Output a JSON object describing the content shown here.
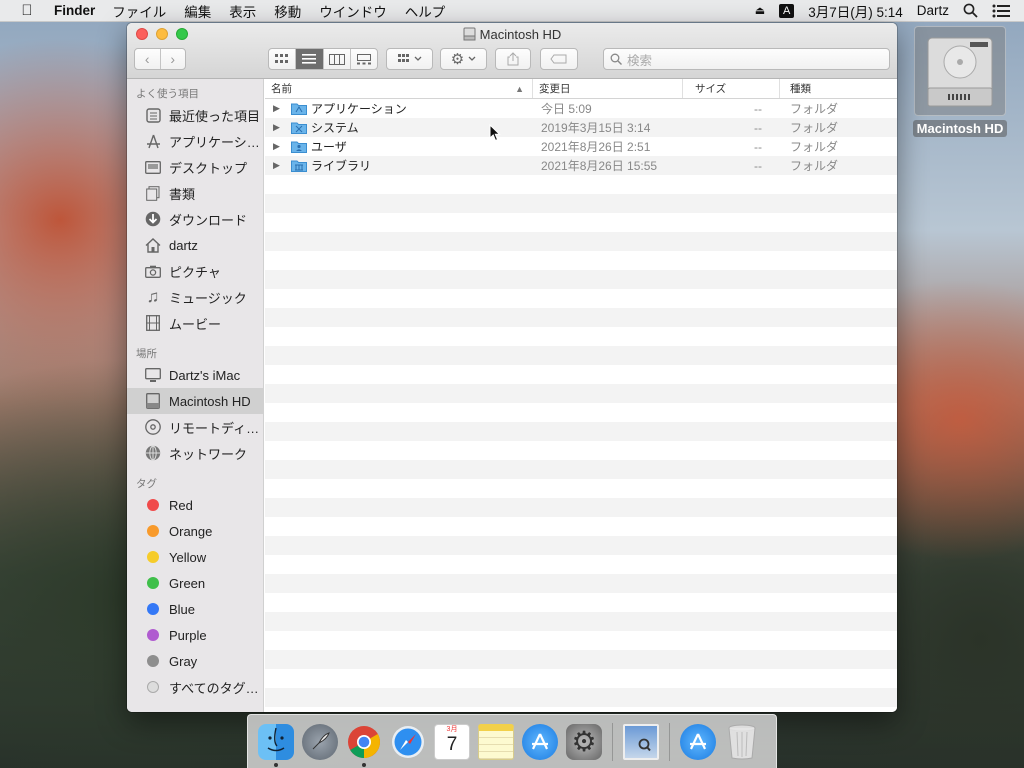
{
  "menubar": {
    "app": "Finder",
    "items": [
      "ファイル",
      "編集",
      "表示",
      "移動",
      "ウインドウ",
      "ヘルプ"
    ],
    "input_mode": "A",
    "datetime": "3月7日(月)  5:14",
    "user": "Dartz"
  },
  "desktop": {
    "hd_label": "Macintosh HD"
  },
  "window": {
    "title": "Macintosh HD",
    "search_placeholder": "検索",
    "sidebar": {
      "favorites_header": "よく使う項目",
      "favorites": [
        "最近使った項目",
        "アプリケーシ…",
        "デスクトップ",
        "書類",
        "ダウンロード",
        "dartz",
        "ピクチャ",
        "ミュージック",
        "ムービー"
      ],
      "places_header": "場所",
      "places": [
        "Dartz's iMac",
        "Macintosh HD",
        "リモートディ…",
        "ネットワーク"
      ],
      "tags_header": "タグ",
      "tags": [
        {
          "label": "Red",
          "color": "#f04a4a"
        },
        {
          "label": "Orange",
          "color": "#f89a2b"
        },
        {
          "label": "Yellow",
          "color": "#f6cc2a"
        },
        {
          "label": "Green",
          "color": "#3fbf4a"
        },
        {
          "label": "Blue",
          "color": "#3478f6"
        },
        {
          "label": "Purple",
          "color": "#b05bd0"
        },
        {
          "label": "Gray",
          "color": "#8e8e8e"
        }
      ],
      "all_tags": "すべてのタグ…"
    },
    "columns": {
      "name": "名前",
      "modified": "変更日",
      "size": "サイズ",
      "kind": "種類"
    },
    "rows": [
      {
        "name": "アプリケーション",
        "modified": "今日 5:09",
        "size": "--",
        "kind": "フォルダ",
        "icon": "applications-folder-icon"
      },
      {
        "name": "システム",
        "modified": "2019年3月15日 3:14",
        "size": "--",
        "kind": "フォルダ",
        "icon": "system-folder-icon"
      },
      {
        "name": "ユーザ",
        "modified": "2021年8月26日 2:51",
        "size": "--",
        "kind": "フォルダ",
        "icon": "users-folder-icon"
      },
      {
        "name": "ライブラリ",
        "modified": "2021年8月26日 15:55",
        "size": "--",
        "kind": "フォルダ",
        "icon": "library-folder-icon"
      }
    ]
  },
  "dock": {
    "calendar_day": "7",
    "calendar_month": "3月"
  }
}
